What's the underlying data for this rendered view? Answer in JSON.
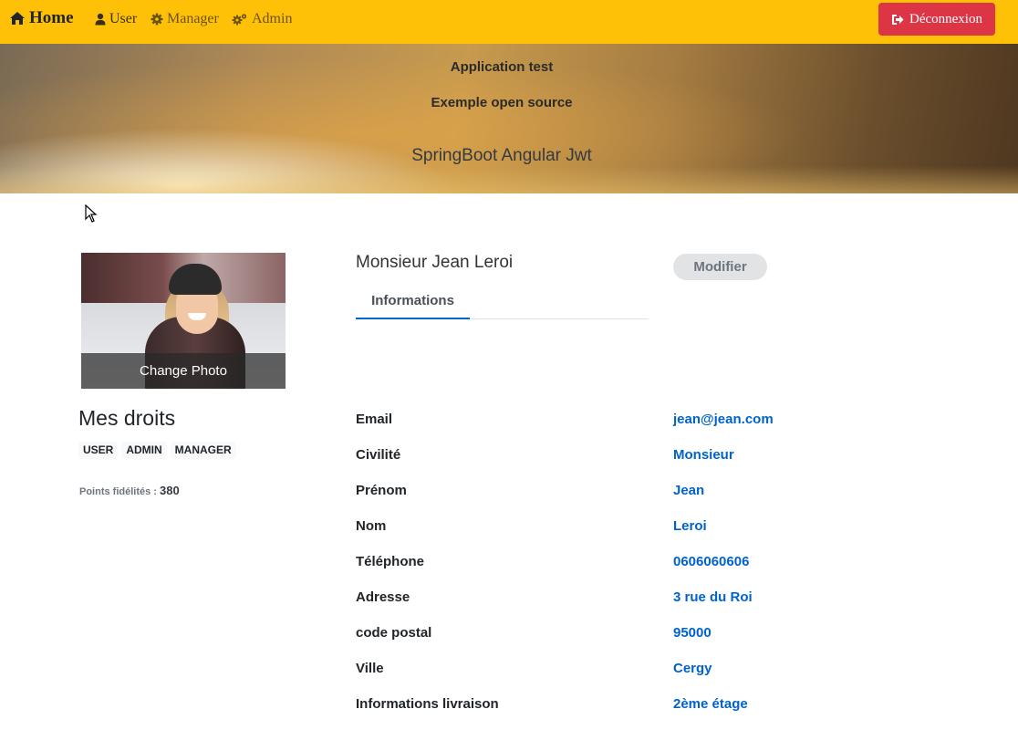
{
  "navbar": {
    "home": "Home",
    "user": "User",
    "manager": "Manager",
    "admin": "Admin",
    "logout": "Déconnexion",
    "bg_color": "#ffc107",
    "logout_color": "#dc3545"
  },
  "banner": {
    "title": "Application test",
    "subtitle": "Exemple open source",
    "tagline": "SpringBoot Angular Jwt"
  },
  "photo": {
    "overlay_label": "Change Photo"
  },
  "rights": {
    "title": "Mes droits",
    "badges": [
      "USER",
      "ADMIN",
      "MANAGER"
    ],
    "points_label": "Points fidélités :",
    "points_value": "380"
  },
  "profile": {
    "name": "Monsieur Jean Leroi",
    "modify_label": "Modifier",
    "tab_label": "Informations",
    "accent_color": "#0062cc"
  },
  "info": [
    {
      "label": "Email",
      "value": "jean@jean.com"
    },
    {
      "label": "Civilité",
      "value": "Monsieur"
    },
    {
      "label": "Prénom",
      "value": "Jean"
    },
    {
      "label": "Nom",
      "value": "Leroi"
    },
    {
      "label": "Téléphone",
      "value": "0606060606"
    },
    {
      "label": "Adresse",
      "value": "3 rue du Roi"
    },
    {
      "label": "code postal",
      "value": "95000"
    },
    {
      "label": "Ville",
      "value": "Cergy"
    },
    {
      "label": "Informations livraison",
      "value": "2ème étage"
    }
  ]
}
